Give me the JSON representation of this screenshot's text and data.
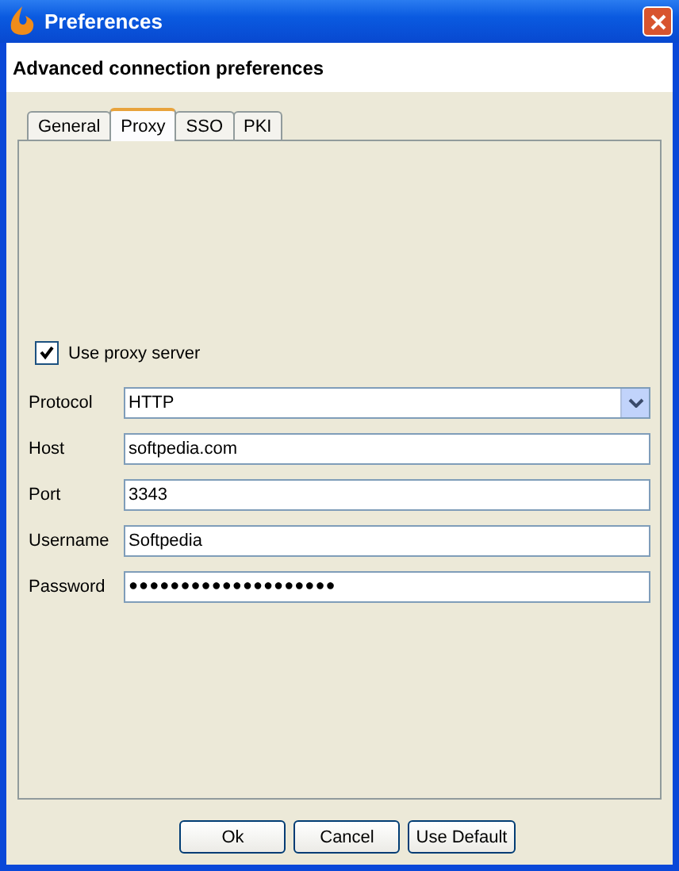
{
  "window": {
    "title": "Preferences"
  },
  "header": "Advanced connection preferences",
  "tabs": [
    {
      "label": "General",
      "selected": false
    },
    {
      "label": "Proxy",
      "selected": true
    },
    {
      "label": "SSO",
      "selected": false
    },
    {
      "label": "PKI",
      "selected": false
    }
  ],
  "use_proxy": {
    "label": "Use proxy server",
    "checked": true
  },
  "fields": [
    {
      "kind": "dropdown",
      "label": "Protocol",
      "value": "HTTP"
    },
    {
      "kind": "text",
      "label": "Host",
      "value": "softpedia.com"
    },
    {
      "kind": "text",
      "label": "Port",
      "value": "3343"
    },
    {
      "kind": "text",
      "label": "Username",
      "value": "Softpedia"
    },
    {
      "kind": "password",
      "label": "Password",
      "value": "●●●●●●●●●●●●●●●●●●●●"
    }
  ],
  "buttons": [
    "Ok",
    "Cancel",
    "Use Default"
  ]
}
